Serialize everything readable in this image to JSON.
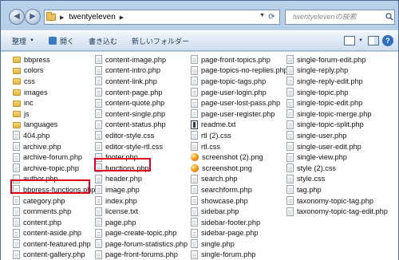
{
  "address": {
    "crumb": "twentyeleven"
  },
  "search": {
    "placeholder": "twentyelevenの検索"
  },
  "toolbar": {
    "organize": "整理",
    "open": "開く",
    "burn": "書き込む",
    "new_folder": "新しいフォルダー"
  },
  "columns": [
    [
      {
        "name": "bbpress",
        "type": "folder"
      },
      {
        "name": "colors",
        "type": "folder"
      },
      {
        "name": "css",
        "type": "folder"
      },
      {
        "name": "images",
        "type": "folder"
      },
      {
        "name": "inc",
        "type": "folder"
      },
      {
        "name": "js",
        "type": "folder"
      },
      {
        "name": "languages",
        "type": "folder"
      },
      {
        "name": "404.php",
        "type": "doc"
      },
      {
        "name": "archive.php",
        "type": "doc"
      },
      {
        "name": "archive-forum.php",
        "type": "doc"
      },
      {
        "name": "archive-topic.php",
        "type": "doc"
      },
      {
        "name": "author.php",
        "type": "doc"
      },
      {
        "name": "bbpress-functions.php",
        "type": "doc"
      },
      {
        "name": "category.php",
        "type": "doc"
      },
      {
        "name": "comments.php",
        "type": "doc"
      },
      {
        "name": "content.php",
        "type": "doc"
      },
      {
        "name": "content-aside.php",
        "type": "doc"
      },
      {
        "name": "content-featured.php",
        "type": "doc"
      },
      {
        "name": "content-gallery.php",
        "type": "doc"
      }
    ],
    [
      {
        "name": "content-image.php",
        "type": "doc"
      },
      {
        "name": "content-intro.php",
        "type": "doc"
      },
      {
        "name": "content-link.php",
        "type": "doc"
      },
      {
        "name": "content-page.php",
        "type": "doc"
      },
      {
        "name": "content-quote.php",
        "type": "doc"
      },
      {
        "name": "content-single.php",
        "type": "doc"
      },
      {
        "name": "content-status.php",
        "type": "doc"
      },
      {
        "name": "editor-style.css",
        "type": "doc"
      },
      {
        "name": "editor-style-rtl.css",
        "type": "doc"
      },
      {
        "name": "footer.php",
        "type": "doc"
      },
      {
        "name": "functions.php",
        "type": "doc"
      },
      {
        "name": "header.php",
        "type": "doc"
      },
      {
        "name": "image.php",
        "type": "doc"
      },
      {
        "name": "index.php",
        "type": "doc"
      },
      {
        "name": "license.txt",
        "type": "doc"
      },
      {
        "name": "page.php",
        "type": "doc"
      },
      {
        "name": "page-create-topic.php",
        "type": "doc"
      },
      {
        "name": "page-forum-statistics.php",
        "type": "doc"
      },
      {
        "name": "page-front-forums.php",
        "type": "doc"
      }
    ],
    [
      {
        "name": "page-front-topics.php",
        "type": "doc"
      },
      {
        "name": "page-topics-no-replies.php",
        "type": "doc"
      },
      {
        "name": "page-topic-tags.php",
        "type": "doc"
      },
      {
        "name": "page-user-login.php",
        "type": "doc"
      },
      {
        "name": "page-user-lost-pass.php",
        "type": "doc"
      },
      {
        "name": "page-user-register.php",
        "type": "doc"
      },
      {
        "name": "readme.txt",
        "type": "readme"
      },
      {
        "name": "rtl (2).css",
        "type": "doc"
      },
      {
        "name": "rtl.css",
        "type": "doc"
      },
      {
        "name": "screenshot (2).png",
        "type": "png"
      },
      {
        "name": "screenshot.png",
        "type": "png"
      },
      {
        "name": "search.php",
        "type": "doc"
      },
      {
        "name": "searchform.php",
        "type": "doc"
      },
      {
        "name": "showcase.php",
        "type": "doc"
      },
      {
        "name": "sidebar.php",
        "type": "doc"
      },
      {
        "name": "sidebar-footer.php",
        "type": "doc"
      },
      {
        "name": "sidebar-page.php",
        "type": "doc"
      },
      {
        "name": "single.php",
        "type": "doc"
      },
      {
        "name": "single-forum.php",
        "type": "doc"
      }
    ],
    [
      {
        "name": "single-forum-edit.php",
        "type": "doc"
      },
      {
        "name": "single-reply.php",
        "type": "doc"
      },
      {
        "name": "single-reply-edit.php",
        "type": "doc"
      },
      {
        "name": "single-topic.php",
        "type": "doc"
      },
      {
        "name": "single-topic-edit.php",
        "type": "doc"
      },
      {
        "name": "single-topic-merge.php",
        "type": "doc"
      },
      {
        "name": "single-topic-split.php",
        "type": "doc"
      },
      {
        "name": "single-user.php",
        "type": "doc"
      },
      {
        "name": "single-user-edit.php",
        "type": "doc"
      },
      {
        "name": "single-view.php",
        "type": "doc"
      },
      {
        "name": "style (2).css",
        "type": "doc"
      },
      {
        "name": "style.css",
        "type": "doc"
      },
      {
        "name": "tag.php",
        "type": "doc"
      },
      {
        "name": "taxonomy-topic-tag.php",
        "type": "doc"
      },
      {
        "name": "taxonomy-topic-tag-edit.php",
        "type": "doc"
      }
    ]
  ]
}
